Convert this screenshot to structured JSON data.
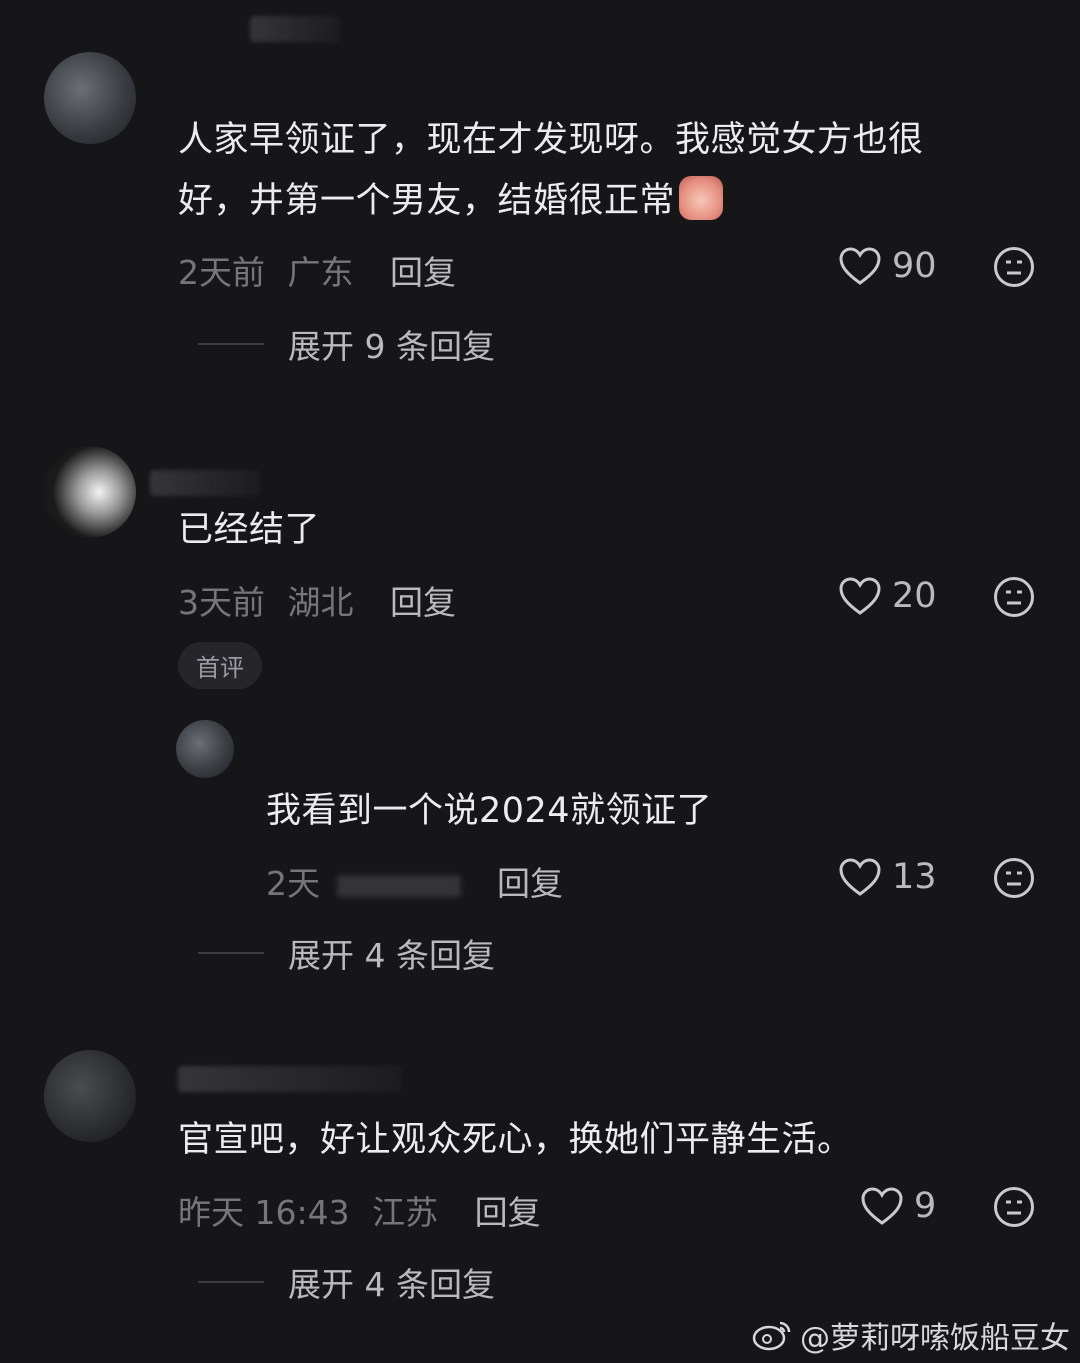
{
  "comments": [
    {
      "text_line1": "人家早领证了，现在才发现呀。我感觉女方也很",
      "text_line2": "好，井第一个男友，结婚很正常",
      "emoji_icon": "crying-face-icon",
      "time": "2天前",
      "location": "广东",
      "reply": "回复",
      "likes": "90",
      "expand": "展开 9 条回复"
    },
    {
      "text": "已经结了",
      "time": "3天前",
      "location": "湖北",
      "reply": "回复",
      "likes": "20",
      "badge": "首评",
      "sub_reply": {
        "text": "我看到一个说2024就领证了",
        "time": "2天",
        "reply": "回复",
        "likes": "13"
      },
      "expand": "展开 4 条回复"
    },
    {
      "text": "官宣吧，好让观众死心，换她们平静生活。",
      "time": "昨天 16:43",
      "location": "江苏",
      "reply": "回复",
      "likes": "9",
      "expand": "展开 4 条回复"
    }
  ],
  "watermark": "@萝莉呀嗦饭船豆女",
  "colors": {
    "background": "#161619",
    "text": "#ececee",
    "meta": "#75757b"
  }
}
